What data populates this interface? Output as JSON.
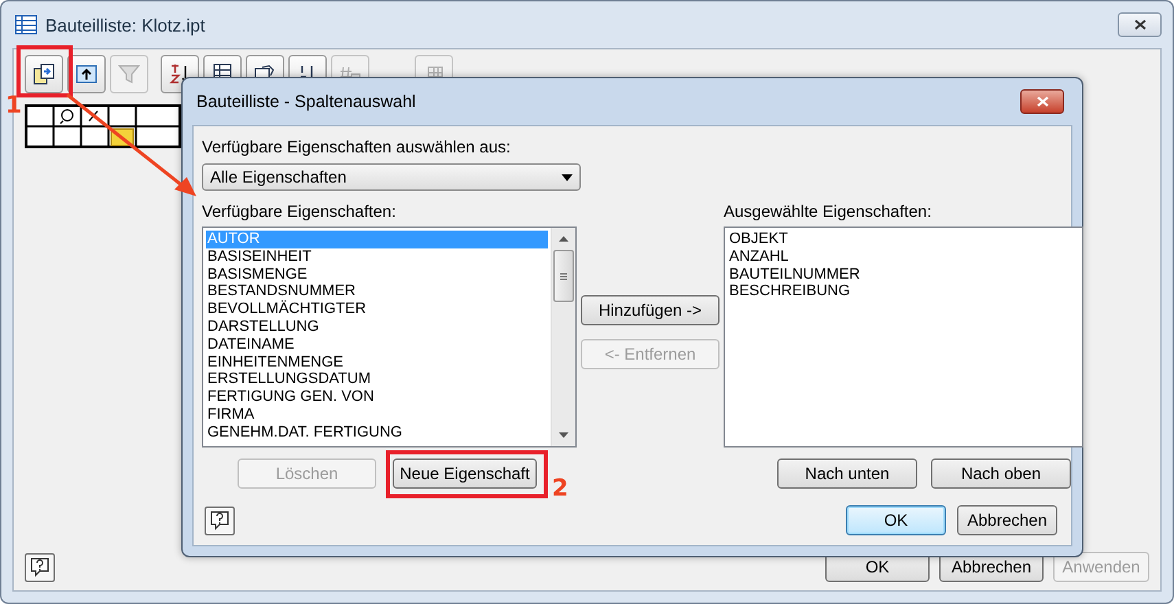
{
  "window": {
    "title": "Bauteilliste: Klotz.ipt"
  },
  "toolbar": [
    {
      "kind": "columns",
      "disabled": false
    },
    {
      "kind": "export",
      "disabled": false
    },
    {
      "kind": "filter",
      "disabled": true
    },
    {
      "kind": "sort",
      "disabled": false
    },
    {
      "kind": "table",
      "disabled": false
    },
    {
      "kind": "view",
      "disabled": false
    },
    {
      "kind": "renumber",
      "disabled": false
    },
    {
      "kind": "number",
      "disabled": true
    },
    {
      "kind": "grid",
      "disabled": true
    }
  ],
  "dialog": {
    "title": "Bauteilliste - Spaltenauswahl",
    "source_label": "Verfügbare Eigenschaften auswählen aus:",
    "source_value": "Alle Eigenschaften",
    "available_label": "Verfügbare Eigenschaften:",
    "available": [
      {
        "label": "AUTOR",
        "selected": true
      },
      {
        "label": "BASISEINHEIT",
        "selected": false
      },
      {
        "label": "BASISMENGE",
        "selected": false
      },
      {
        "label": "BESTANDSNUMMER",
        "selected": false
      },
      {
        "label": "BEVOLLMÄCHTIGTER",
        "selected": false
      },
      {
        "label": "DARSTELLUNG",
        "selected": false
      },
      {
        "label": "DATEINAME",
        "selected": false
      },
      {
        "label": "EINHEITENMENGE",
        "selected": false
      },
      {
        "label": "ERSTELLUNGSDATUM",
        "selected": false
      },
      {
        "label": "FERTIGUNG GEN. VON",
        "selected": false
      },
      {
        "label": "FIRMA",
        "selected": false
      },
      {
        "label": "GENEHM.DAT. FERTIGUNG",
        "selected": false
      }
    ],
    "transfer_buttons": [
      {
        "label": "Hinzufügen ->",
        "disabled": false
      },
      {
        "label": "<- Entfernen",
        "disabled": true
      }
    ],
    "selected_label": "Ausgewählte Eigenschaften:",
    "selected": [
      {
        "label": "OBJEKT"
      },
      {
        "label": "ANZAHL"
      },
      {
        "label": "BAUTEILNUMMER"
      },
      {
        "label": "BESCHREIBUNG"
      }
    ],
    "left_buttons": [
      {
        "label": "Löschen",
        "disabled": true
      },
      {
        "label": "Neue Eigenschaft",
        "disabled": false
      }
    ],
    "order_buttons": [
      {
        "label": "Nach unten",
        "disabled": false
      },
      {
        "label": "Nach oben",
        "disabled": false
      }
    ],
    "footer_buttons": [
      {
        "label": "OK",
        "disabled": false,
        "default": true
      },
      {
        "label": "Abbrechen",
        "disabled": false,
        "default": false
      }
    ]
  },
  "footer_buttons": [
    {
      "label": "OK",
      "disabled": false
    },
    {
      "label": "Abbrechen",
      "disabled": false
    },
    {
      "label": "Anwenden",
      "disabled": true
    }
  ],
  "annotations": [
    {
      "label": "1"
    },
    {
      "label": "2"
    }
  ]
}
